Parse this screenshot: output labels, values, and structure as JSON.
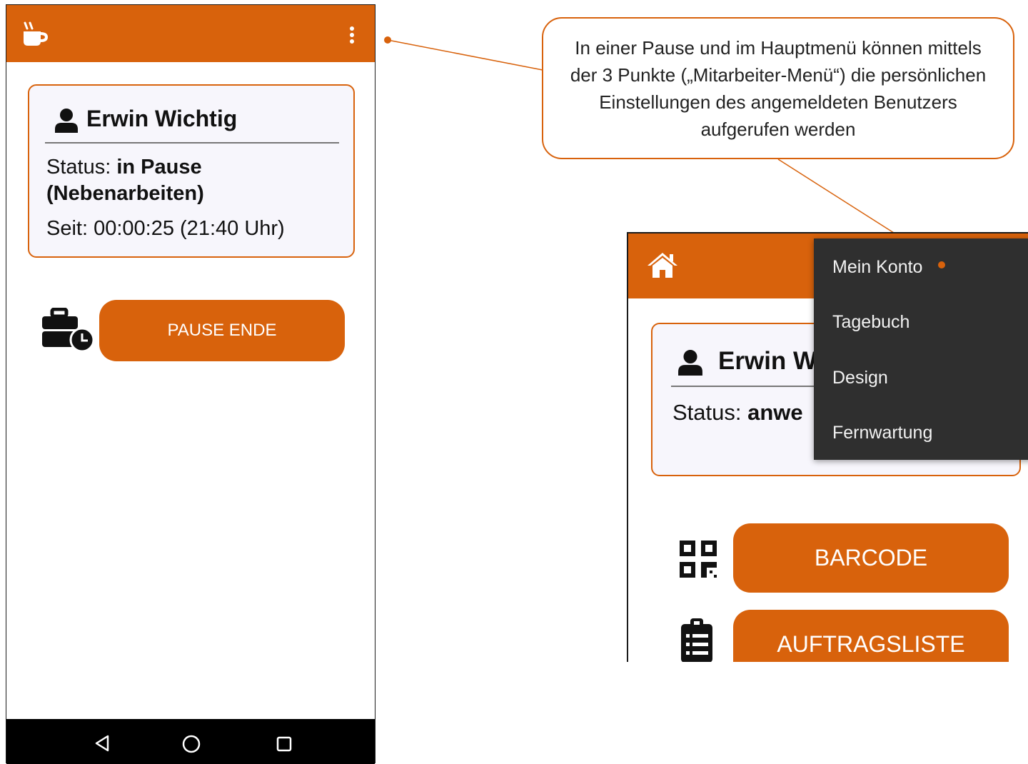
{
  "left_phone": {
    "appbar": {
      "app_icon": "coffee-break-icon",
      "menu_icon": "more-vert-icon"
    },
    "user_card": {
      "user_icon": "person-icon",
      "name": "Erwin Wichtig",
      "status_label": "Status:",
      "status_value_line1": "in Pause",
      "status_value_line2": "(Nebenarbeiten)",
      "since": "Seit: 00:00:25 (21:40 Uhr)"
    },
    "actions": [
      {
        "icon": "briefcase-clock-icon",
        "label": "PAUSE ENDE"
      }
    ],
    "navbar": {
      "back_icon": "back-triangle-icon",
      "home_icon": "home-circle-icon",
      "recents_icon": "recents-square-icon"
    }
  },
  "callout": {
    "text": "In einer Pause und im Hauptmenü können mittels der 3 Punkte („Mitarbeiter-Menü“) die persönlichen Einstellungen des angemeldeten Benutzers aufgerufen werden"
  },
  "right_phone": {
    "appbar": {
      "home_icon": "house-icon"
    },
    "user_card": {
      "user_icon": "person-icon",
      "name_partial": "Erwin W",
      "status_label": "Status:",
      "status_value_partial": "anwe"
    },
    "overflow_menu": {
      "items": [
        {
          "label": "Mein Konto"
        },
        {
          "label": "Tagebuch"
        },
        {
          "label": "Design"
        },
        {
          "label": "Fernwartung"
        }
      ]
    },
    "actions": [
      {
        "icon": "qr-code-icon",
        "label": "BARCODE"
      },
      {
        "icon": "clipboard-list-icon",
        "label": "AUFTRAGSLISTE"
      }
    ]
  },
  "colors": {
    "accent": "#d8620c",
    "menu_bg": "#2f2f2f",
    "card_bg": "#f7f6fc"
  }
}
